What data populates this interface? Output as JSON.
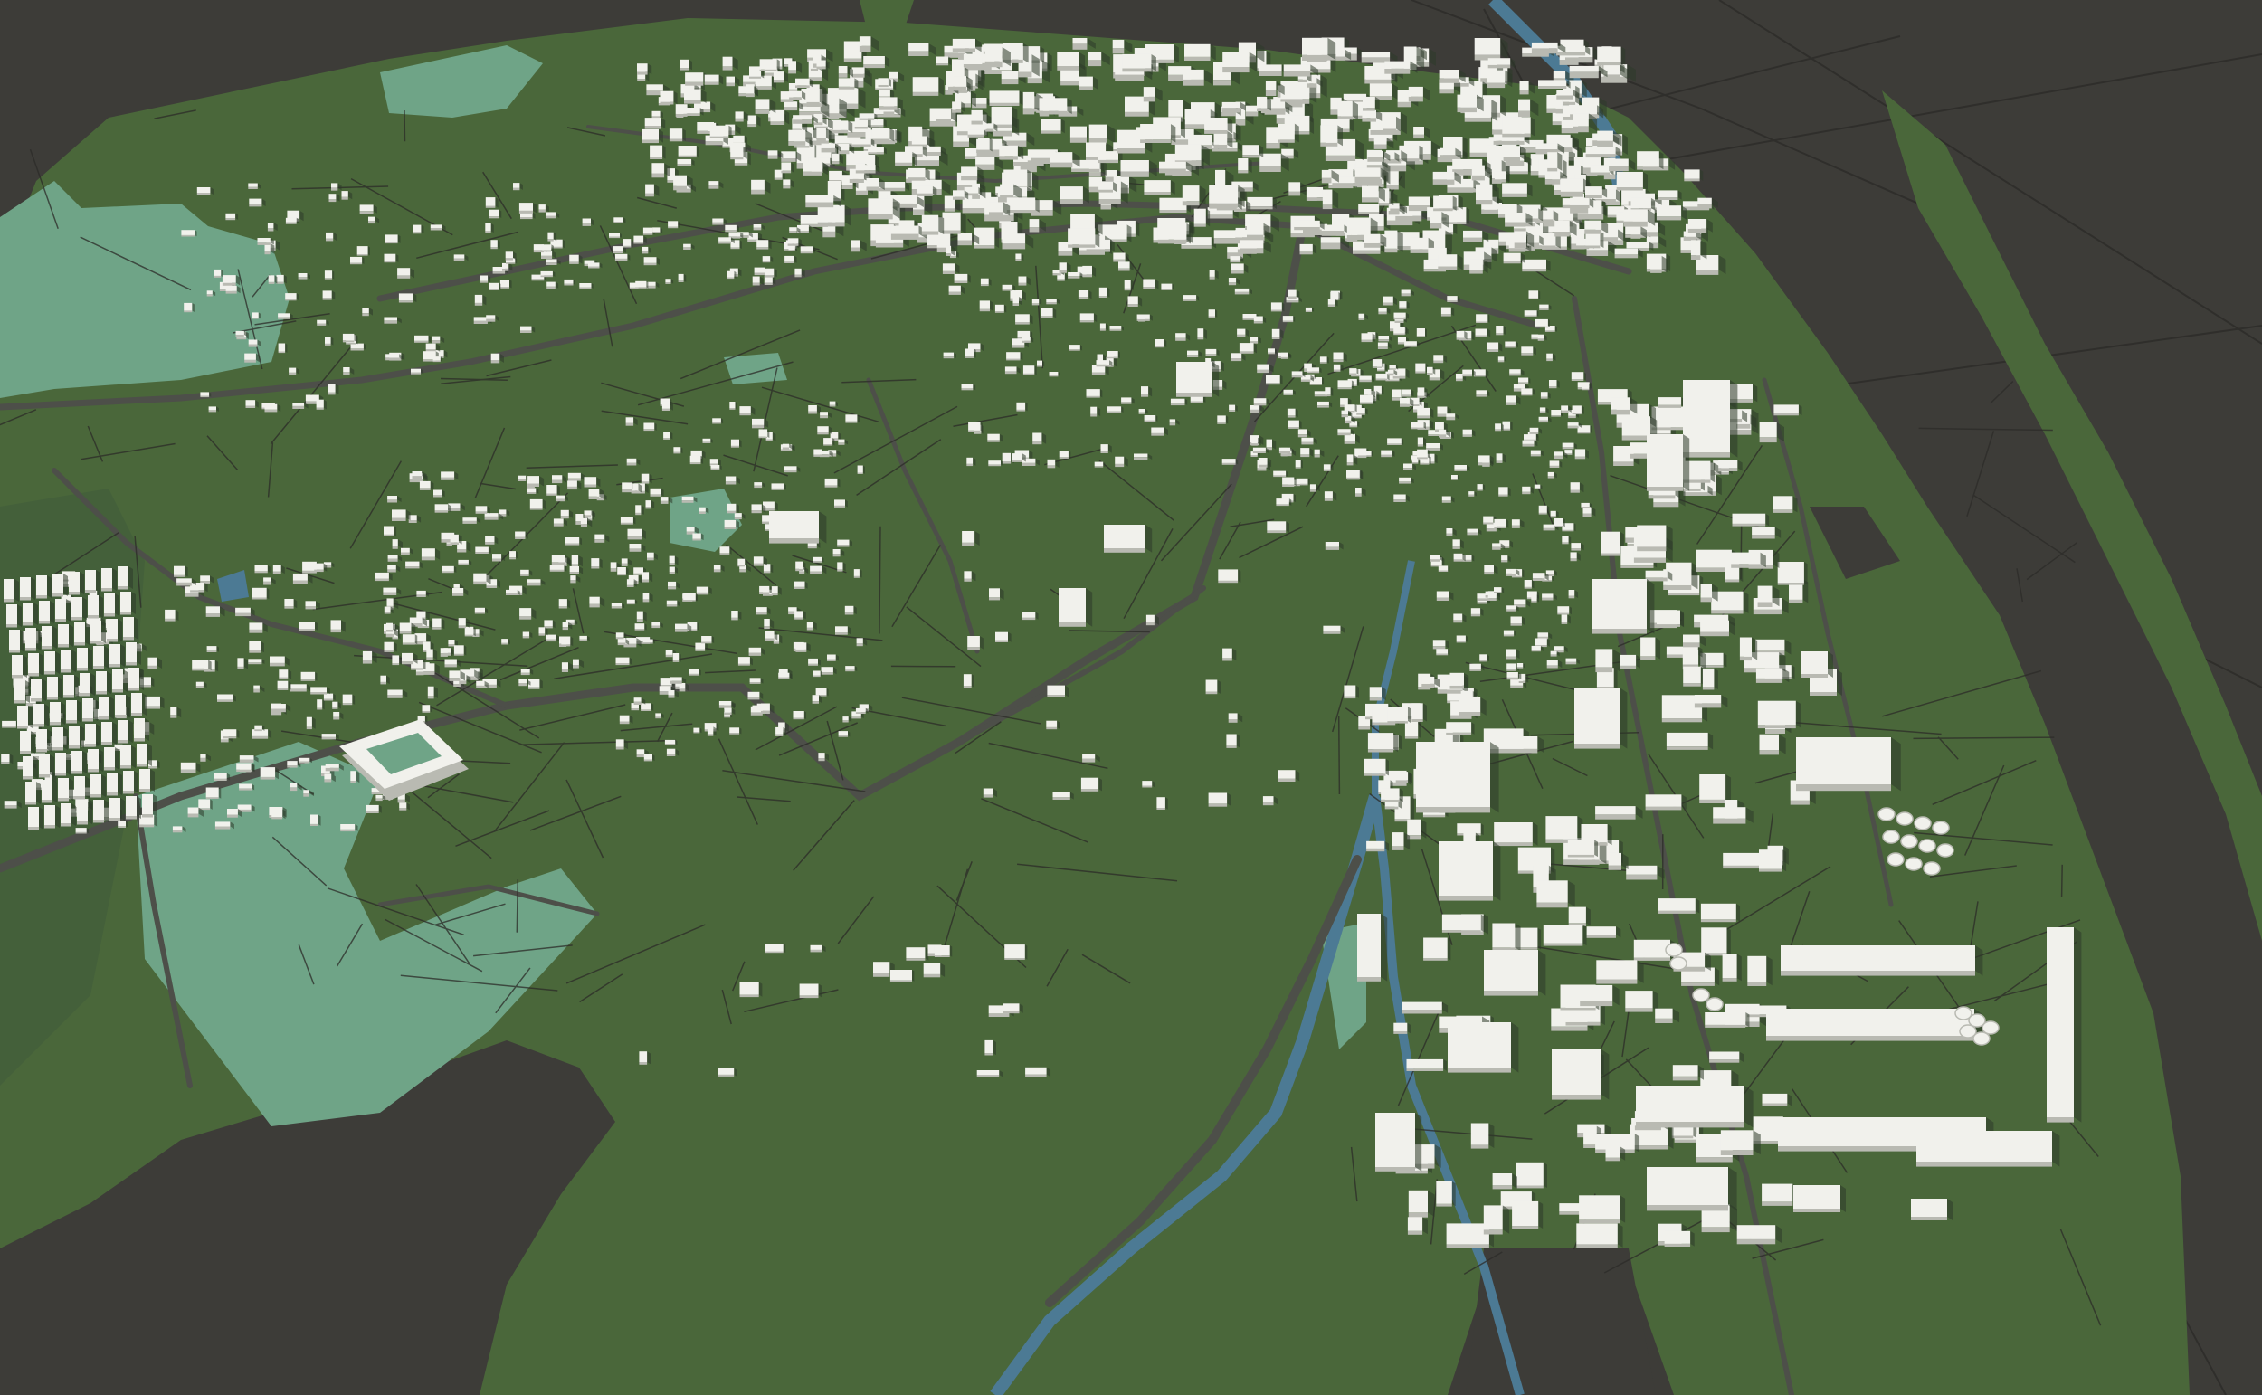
{
  "scene": {
    "kind": "3d-city-model-render",
    "labels_visible": false
  },
  "colors": {
    "background": "#3d3c38",
    "land": "#4a673a",
    "land_dark": "#44603a",
    "parks": "#6fa487",
    "water": "#4c7a94",
    "roads": "#4d4f49",
    "building_top": "#f1f1ec",
    "building_side": "#b9bab2",
    "building_shadow": "#2e3a29",
    "grid_lines": "#2c2b28"
  },
  "layers": [
    "terrain",
    "parks",
    "waterways",
    "roads",
    "buildings"
  ],
  "features": {
    "waterways": [
      "river-north",
      "canal-southeast"
    ],
    "parks": [
      "park-west-field",
      "park-southwest-large",
      "park-north",
      "park-center-pond"
    ],
    "landmarks": [
      "stadium",
      "industrial-warehouses",
      "oil-tanks"
    ]
  }
}
